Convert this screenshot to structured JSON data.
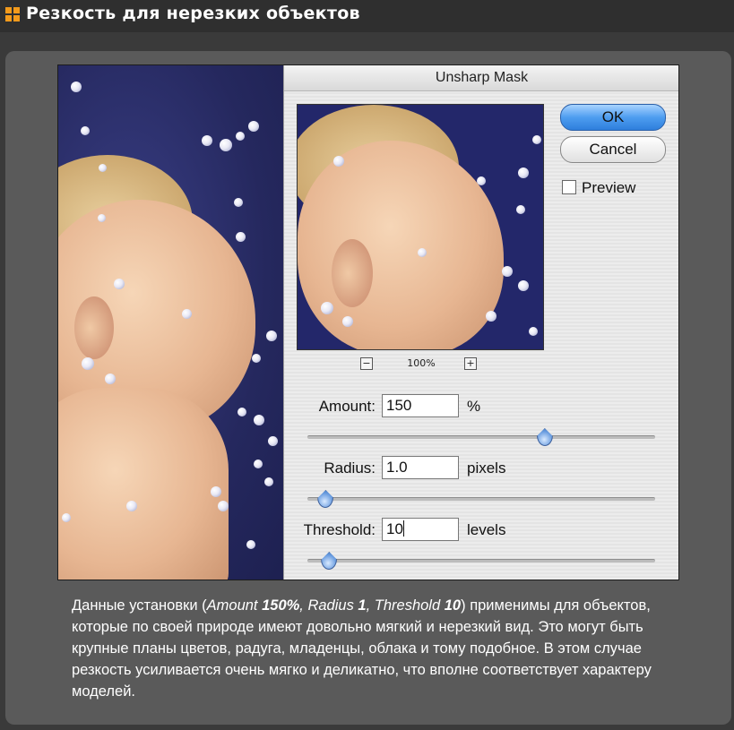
{
  "header": {
    "title": "Резкость для нерезких объектов"
  },
  "dialog": {
    "title": "Unsharp Mask",
    "ok_label": "OK",
    "cancel_label": "Cancel",
    "preview_label": "Preview",
    "zoom_minus": "−",
    "zoom_plus": "+",
    "zoom_level": "100%",
    "amount": {
      "label": "Amount:",
      "value": "150",
      "unit": "%",
      "slider_fraction": 0.68
    },
    "radius": {
      "label": "Radius:",
      "value": "1.0",
      "unit": "pixels",
      "slider_fraction": 0.05
    },
    "threshold": {
      "label": "Threshold:",
      "value": "10",
      "unit": "levels",
      "slider_fraction": 0.06
    }
  },
  "description": {
    "t1": "Данные установки (",
    "amount_word": "Amount ",
    "amount_val": "150%",
    "sep1": ", ",
    "radius_word": "Radius ",
    "radius_val": "1",
    "sep2": ", ",
    "threshold_word": "Threshold ",
    "threshold_val": "10",
    "t2": ") применимы для объектов, которые по своей природе имеют довольно мягкий и нерезкий вид. Это могут быть крупные планы цветов, радуга, младенцы, облака и тому подобное. В этом случае резкость усиливается очень мягко и деликатно, что вполне соответствует характеру моделей."
  },
  "colors": {
    "header_bg": "#2f2f2f",
    "panel_bg": "#5a5a5a",
    "icon_accent": "#f29a1c",
    "ok_button": "#4e9df0",
    "photo_background": "#2e3370"
  }
}
